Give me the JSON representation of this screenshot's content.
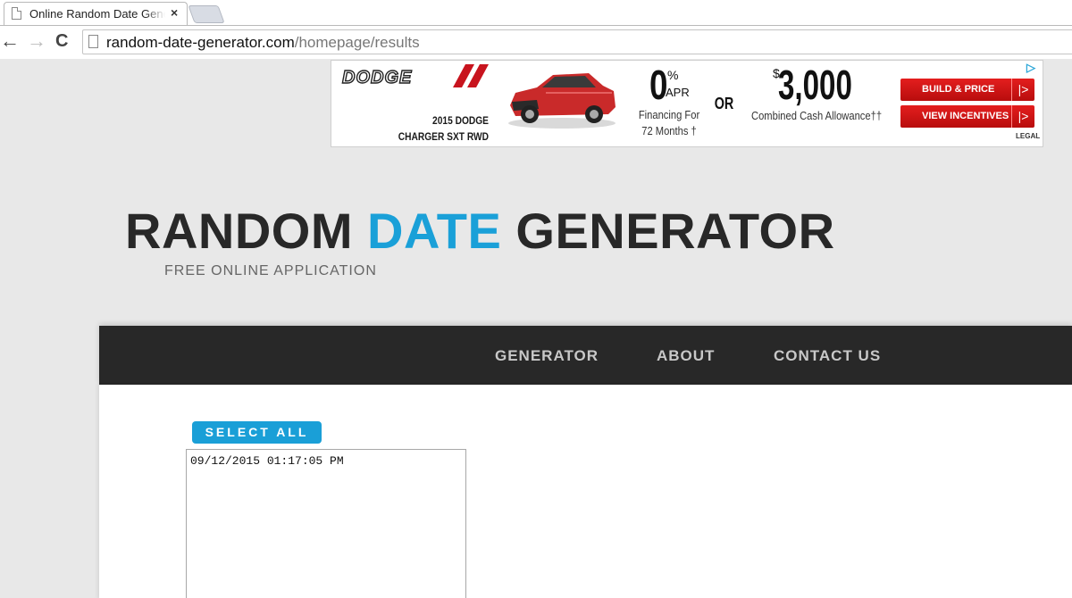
{
  "browser": {
    "tab_title": "Online Random Date Generator",
    "tab_close": "×",
    "back_icon": "←",
    "forward_icon": "→",
    "reload_icon": "C",
    "url_host": "random-date-generator.com",
    "url_path": "/homepage/results"
  },
  "ad": {
    "brand": "DODGE",
    "model_line1": "2015 DODGE",
    "model_line2": "CHARGER SXT RWD",
    "apr_value": "0",
    "apr_percent": "%",
    "apr_label": "APR",
    "financing_line1": "Financing For",
    "financing_line2": "72 Months †",
    "or": "OR",
    "cash_symbol": "$",
    "cash_value": "3,000",
    "cash_label": "Combined Cash Allowance††",
    "build_button": "BUILD & PRICE",
    "incentives_button": "VIEW INCENTIVES",
    "button_chevron": "|>",
    "legal": "LEGAL",
    "adchoices_icon": "▷",
    "colors": {
      "brand_red": "#c8141e",
      "adchoices": "#2aa6d8"
    }
  },
  "site": {
    "title_part1": "RANDOM ",
    "title_accent": "DATE",
    "title_part2": " GENERATOR",
    "tagline": "FREE ONLINE APPLICATION",
    "colors": {
      "accent": "#1aa0d8",
      "dark": "#282828"
    }
  },
  "nav": {
    "items": [
      {
        "label": "GENERATOR"
      },
      {
        "label": "ABOUT"
      },
      {
        "label": "CONTACT US"
      }
    ]
  },
  "main": {
    "select_all_label": "SELECT ALL",
    "results_value": "09/12/2015 01:17:05 PM"
  }
}
